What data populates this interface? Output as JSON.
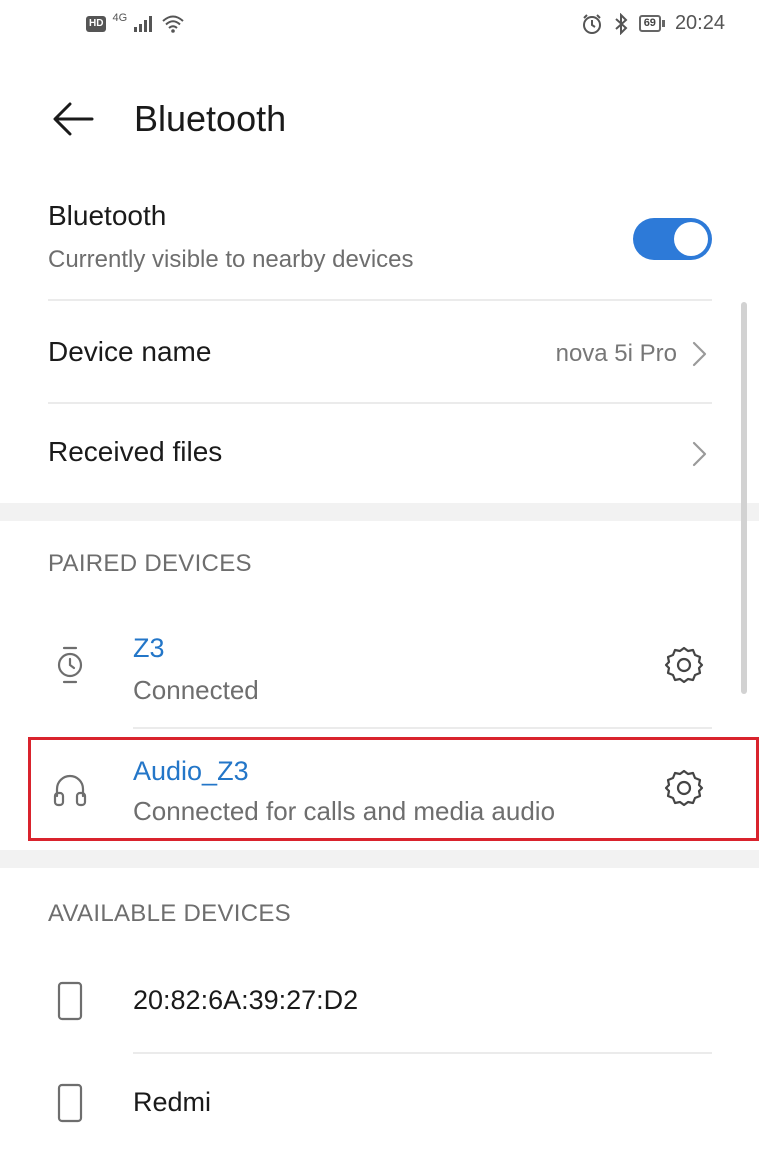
{
  "status_bar": {
    "hd_label": "HD",
    "network_label": "4G",
    "time": "20:24",
    "battery": "69"
  },
  "header": {
    "title": "Bluetooth"
  },
  "bluetooth_toggle": {
    "label": "Bluetooth",
    "sublabel": "Currently visible to nearby devices",
    "enabled": true,
    "accent_color": "#2d7ad8"
  },
  "device_name": {
    "label": "Device name",
    "value": "nova 5i Pro"
  },
  "received_files": {
    "label": "Received files"
  },
  "paired_devices": {
    "heading": "PAIRED DEVICES",
    "items": [
      {
        "name": "Z3",
        "status": "Connected",
        "icon": "watch-icon"
      },
      {
        "name": "Audio_Z3",
        "status": "Connected for calls and media audio",
        "icon": "headphones-icon",
        "highlighted": true
      }
    ],
    "name_color": "#2376c8",
    "highlight_color": "#d9232d"
  },
  "available_devices": {
    "heading": "AVAILABLE DEVICES",
    "items": [
      {
        "name": "20:82:6A:39:27:D2",
        "icon": "phone-icon"
      },
      {
        "name": "Redmi",
        "icon": "phone-icon"
      }
    ]
  }
}
